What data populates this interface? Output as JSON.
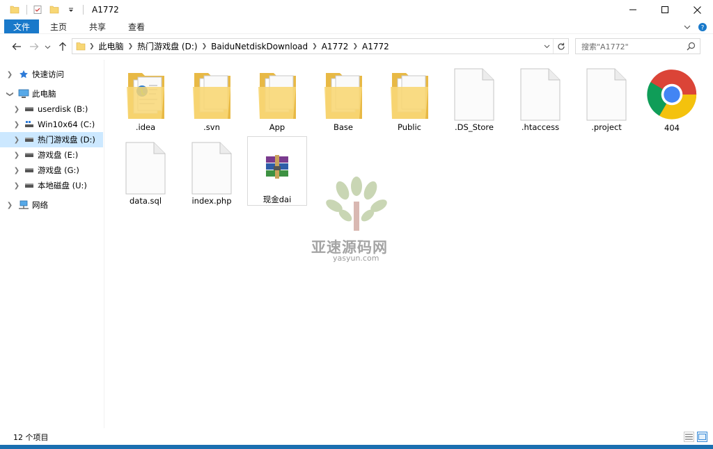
{
  "window": {
    "title": "A1772",
    "controls": {
      "minimize": "minimize",
      "maximize": "maximize",
      "close": "close"
    }
  },
  "ribbon": {
    "tabs": [
      {
        "label": "文件",
        "active": true
      },
      {
        "label": "主页"
      },
      {
        "label": "共享"
      },
      {
        "label": "查看"
      }
    ]
  },
  "address": {
    "crumbs": [
      "此电脑",
      "热门游戏盘 (D:)",
      "BaiduNetdiskDownload",
      "A1772",
      "A1772"
    ],
    "search_placeholder": "搜索\"A1772\""
  },
  "nav": {
    "quick_access": "快速访问",
    "this_pc": "此电脑",
    "drives": [
      {
        "label": "userdisk (B:)"
      },
      {
        "label": "Win10x64 (C:)"
      },
      {
        "label": "热门游戏盘 (D:)",
        "selected": true
      },
      {
        "label": "游戏盘 (E:)"
      },
      {
        "label": "游戏盘 (G:)"
      },
      {
        "label": "本地磁盘 (U:)"
      }
    ],
    "network": "网络"
  },
  "files": [
    {
      "name": ".idea",
      "type": "folder-special"
    },
    {
      "name": ".svn",
      "type": "folder"
    },
    {
      "name": "App",
      "type": "folder"
    },
    {
      "name": "Base",
      "type": "folder"
    },
    {
      "name": "Public",
      "type": "folder"
    },
    {
      "name": ".DS_Store",
      "type": "file"
    },
    {
      "name": ".htaccess",
      "type": "file"
    },
    {
      "name": ".project",
      "type": "file"
    },
    {
      "name": "404",
      "type": "chrome"
    },
    {
      "name": "data.sql",
      "type": "file"
    },
    {
      "name": "index.php",
      "type": "file"
    },
    {
      "name": "现金dai",
      "type": "archive"
    }
  ],
  "watermark": {
    "title": "亚速源码网",
    "url": "yasyun.com"
  },
  "status": {
    "count": "12 个项目"
  },
  "colors": {
    "accent": "#1979ca",
    "selected": "#cce8ff",
    "folder": "#f8d775",
    "folder_dark": "#e8b945"
  }
}
